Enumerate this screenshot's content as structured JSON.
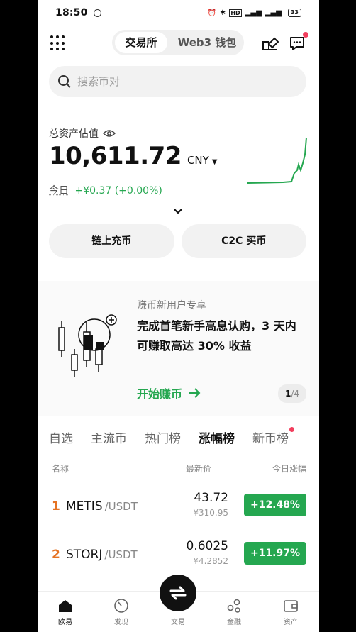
{
  "status_bar": {
    "time": "18:50",
    "signal_text": "HD",
    "battery": "33"
  },
  "top_nav": {
    "tab_exchange": "交易所",
    "tab_web3": "Web3 钱包"
  },
  "search": {
    "placeholder": "搜索币对"
  },
  "assets": {
    "label": "总资产估值",
    "value": "10,611.72",
    "currency": "CNY",
    "pnl_label": "今日",
    "pnl_value": "+¥0.37 (+0.00%)"
  },
  "actions": {
    "deposit": "链上充币",
    "c2c": "C2C 买币"
  },
  "banner": {
    "subtitle": "赚币新用户专享",
    "title": "完成首笔新手高息认购，3 天内可赚取高达 30% 收益",
    "cta": "开始赚币",
    "page_current": "1",
    "page_total": "/4"
  },
  "market_tabs": [
    "自选",
    "主流币",
    "热门榜",
    "涨幅榜",
    "新币榜"
  ],
  "table": {
    "col_name": "名称",
    "col_price": "最新价",
    "col_change": "今日涨幅",
    "rows": [
      {
        "rank": "1",
        "symbol": "METIS",
        "quote": "/USDT",
        "price": "43.72",
        "fiat": "¥310.95",
        "change": "+12.48%"
      },
      {
        "rank": "2",
        "symbol": "STORJ",
        "quote": "/USDT",
        "price": "0.6025",
        "fiat": "¥4.2852",
        "change": "+11.97%"
      }
    ]
  },
  "bottom_nav": [
    "欧易",
    "发现",
    "交易",
    "金融",
    "资产"
  ],
  "colors": {
    "green": "#25a750",
    "red_dot": "#f23e5d",
    "rank_orange": "#e57324"
  }
}
